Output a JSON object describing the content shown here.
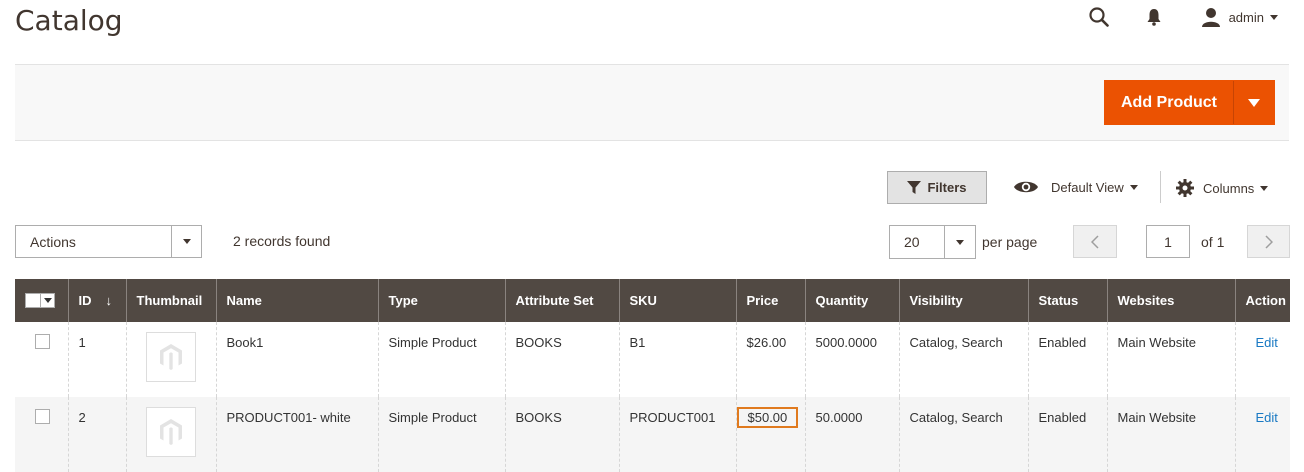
{
  "header": {
    "title": "Catalog",
    "user": "admin",
    "icons": [
      "search-icon",
      "bell-icon",
      "user-icon"
    ]
  },
  "action_bar": {
    "add_product_label": "Add Product"
  },
  "toolbar": {
    "filters_label": "Filters",
    "default_view_label": "Default View",
    "columns_label": "Columns"
  },
  "grid_controls": {
    "actions_label": "Actions",
    "records_found": "2 records found",
    "per_page_value": "20",
    "per_page_label": "per page",
    "page_value": "1",
    "page_of": "of 1"
  },
  "table": {
    "columns": [
      "ID",
      "Thumbnail",
      "Name",
      "Type",
      "Attribute Set",
      "SKU",
      "Price",
      "Quantity",
      "Visibility",
      "Status",
      "Websites",
      "Action"
    ],
    "rows": [
      {
        "id": "1",
        "name": "Book1",
        "type": "Simple Product",
        "attribute_set": "BOOKS",
        "sku": "B1",
        "price": "$26.00",
        "quantity": "5000.0000",
        "visibility": "Catalog, Search",
        "status": "Enabled",
        "websites": "Main Website",
        "action": "Edit"
      },
      {
        "id": "2",
        "name": "PRODUCT001- white",
        "type": "Simple Product",
        "attribute_set": "BOOKS",
        "sku": "PRODUCT001",
        "price": "$50.00",
        "quantity": "50.0000",
        "visibility": "Catalog, Search",
        "status": "Enabled",
        "websites": "Main Website",
        "action": "Edit"
      }
    ],
    "sort_indicator": "↓",
    "highlight_color": "#e07a1e"
  },
  "colors": {
    "accent": "#eb5202",
    "header_bg": "#514943",
    "link": "#1979c3"
  }
}
